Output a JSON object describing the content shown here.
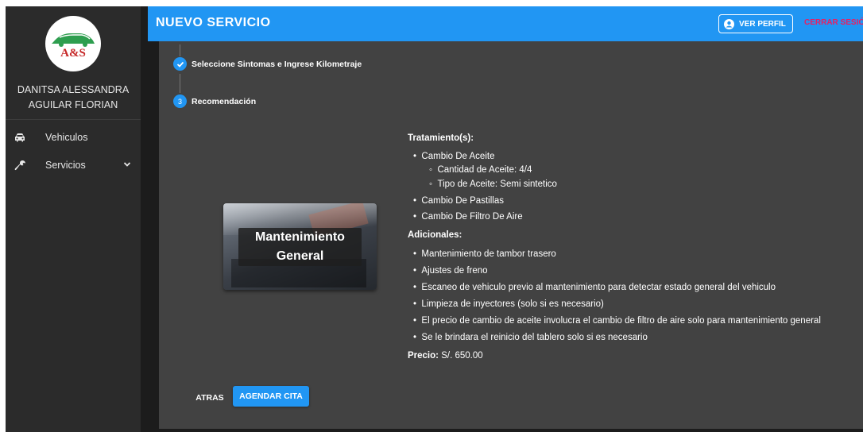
{
  "sidebar": {
    "logo_text": "A&S",
    "user_name_line1": "DANITSA ALESSANDRA",
    "user_name_line2": "AGUILAR FLORIAN",
    "items": [
      {
        "label": "Vehiculos",
        "icon": "car-icon"
      },
      {
        "label": "Servicios",
        "icon": "wrench-icon"
      }
    ]
  },
  "header": {
    "title": "NUEVO SERVICIO",
    "ver_perfil": "VER PERFIL",
    "cerrar_sesion": "CERRAR SESIÓN"
  },
  "stepper": {
    "steps": [
      {
        "label": "Seleccione Sintomas e Ingrese Kilometraje",
        "state": "completed"
      },
      {
        "label": "Recomendación",
        "number": "3",
        "state": "active"
      }
    ]
  },
  "recommendation": {
    "card_title_line1": "Mantenimiento",
    "card_title_line2": "General",
    "treatments_heading": "Tratamiento(s):",
    "treatments": [
      {
        "label": "Cambio De Aceite",
        "sub": [
          "Cantidad de Aceite: 4/4",
          "Tipo de Aceite: Semi sintetico"
        ]
      },
      {
        "label": "Cambio De Pastillas"
      },
      {
        "label": "Cambio De Filtro De Aire"
      }
    ],
    "additionals_heading": "Adicionales:",
    "additionals": [
      "Mantenimiento de tambor trasero",
      "Ajustes de freno",
      "Escaneo de vehiculo previo al mantenimiento para detectar estado general del vehiculo",
      "Limpieza de inyectores (solo si es necesario)",
      "El precio de cambio de aceite involucra el cambio de filtro de aire solo para mantenimiento general",
      "Se le brindara el reinicio del tablero solo si es necesario"
    ],
    "price_label": "Precio:",
    "price_value": "S/. 650.00"
  },
  "actions": {
    "back": "ATRAS",
    "schedule": "AGENDAR CITA"
  },
  "colors": {
    "primary": "#2196f3",
    "logout": "#e91e63",
    "panel": "#424242",
    "sidebar": "#2b2b2b"
  }
}
